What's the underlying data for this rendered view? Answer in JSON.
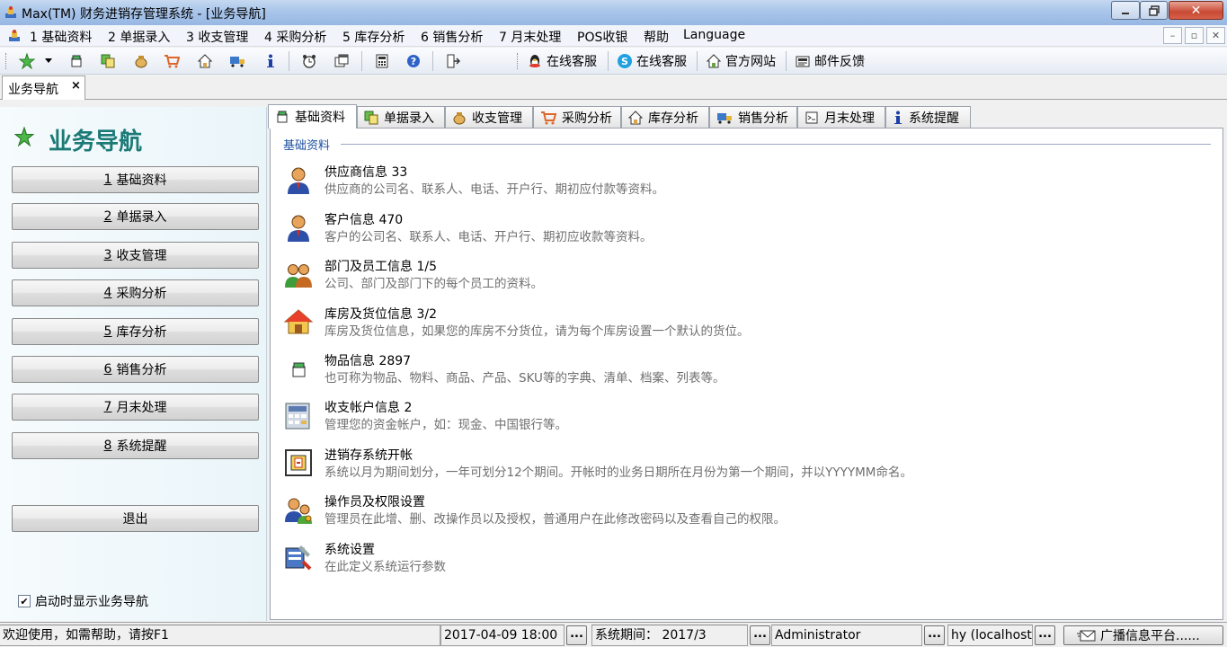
{
  "window": {
    "title": "Max(TM) 财务进销存管理系统 - [业务导航]"
  },
  "menu": {
    "items": [
      "1 基础资料",
      "2 单据录入",
      "3 收支管理",
      "4 采购分析",
      "5 库存分析",
      "6 销售分析",
      "7 月末处理",
      "POS收银",
      "帮助",
      "Language"
    ]
  },
  "toolbar": {
    "text_buttons": [
      "在线客服",
      "在线客服",
      "官方网站",
      "邮件反馈"
    ]
  },
  "doc_tab": {
    "label": "业务导航",
    "close": "×"
  },
  "left_panel": {
    "title": "业务导航",
    "nav": [
      {
        "num": "1",
        "label": "基础资料"
      },
      {
        "num": "2",
        "label": "单据录入"
      },
      {
        "num": "3",
        "label": "收支管理"
      },
      {
        "num": "4",
        "label": "采购分析"
      },
      {
        "num": "5",
        "label": "库存分析"
      },
      {
        "num": "6",
        "label": "销售分析"
      },
      {
        "num": "7",
        "label": "月末处理"
      },
      {
        "num": "8",
        "label": "系统提醒"
      }
    ],
    "exit_label": "退出",
    "startup_checkbox": {
      "label": "启动时显示业务导航",
      "checked": true
    }
  },
  "content_tabs": [
    "基础资料",
    "单据录入",
    "收支管理",
    "采购分析",
    "库存分析",
    "销售分析",
    "月末处理",
    "系统提醒"
  ],
  "active_tab": "基础资料",
  "section": {
    "title": "基础资料",
    "items": [
      {
        "icon": "supplier-icon",
        "title": "供应商信息 33",
        "desc": "供应商的公司名、联系人、电话、开户行、期初应付款等资料。"
      },
      {
        "icon": "customer-icon",
        "title": "客户信息 470",
        "desc": "客户的公司名、联系人、电话、开户行、期初应收款等资料。"
      },
      {
        "icon": "staff-icon",
        "title": "部门及员工信息 1/5",
        "desc": "公司、部门及部门下的每个员工的资料。"
      },
      {
        "icon": "warehouse-icon",
        "title": "库房及货位信息 3/2",
        "desc": "库房及货位信息，如果您的库房不分货位，请为每个库房设置一个默认的货位。"
      },
      {
        "icon": "goods-icon",
        "title": "物品信息 2897",
        "desc": "也可称为物品、物料、商品、产品、SKU等的字典、清单、档案、列表等。"
      },
      {
        "icon": "account-icon",
        "title": "收支帐户信息 2",
        "desc": "管理您的资金帐户，如：现金、中国银行等。"
      },
      {
        "icon": "period-icon",
        "title": "进销存系统开帐",
        "desc": "系统以月为期间划分，一年可划分12个期间。开帐时的业务日期所在月份为第一个期间，并以YYYYMM命名。"
      },
      {
        "icon": "operator-icon",
        "title": "操作员及权限设置",
        "desc": "管理员在此增、删、改操作员以及授权，普通用户在此修改密码以及查看自己的权限。"
      },
      {
        "icon": "settings-icon",
        "title": "系统设置",
        "desc": "在此定义系统运行参数"
      }
    ]
  },
  "status": {
    "welcome": "欢迎使用，如需帮助，请按F1",
    "datetime": "2017-04-09 18:00",
    "period": "系统期间：  2017/3",
    "user": "Administrator",
    "host": "hy (localhost)",
    "broadcast": "广播信息平台......",
    "more": "..."
  },
  "colors": {
    "accent_title": "#1b7a76",
    "section_title": "#1c4fa0"
  }
}
